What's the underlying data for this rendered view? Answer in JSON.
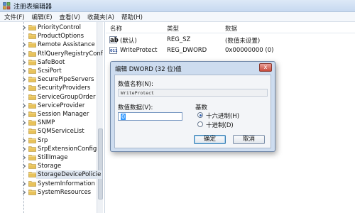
{
  "window": {
    "title": "注册表编辑器"
  },
  "menu": [
    "文件(F)",
    "编辑(E)",
    "查看(V)",
    "收藏夹(A)",
    "帮助(H)"
  ],
  "tree": {
    "items": [
      {
        "label": "PriorityControl",
        "expandable": true
      },
      {
        "label": "ProductOptions",
        "expandable": false
      },
      {
        "label": "Remote Assistance",
        "expandable": true
      },
      {
        "label": "RtlQueryRegistryConf",
        "expandable": true
      },
      {
        "label": "SafeBoot",
        "expandable": true
      },
      {
        "label": "ScsiPort",
        "expandable": true
      },
      {
        "label": "SecurePipeServers",
        "expandable": true
      },
      {
        "label": "SecurityProviders",
        "expandable": true
      },
      {
        "label": "ServiceGroupOrder",
        "expandable": false
      },
      {
        "label": "ServiceProvider",
        "expandable": true
      },
      {
        "label": "Session Manager",
        "expandable": true
      },
      {
        "label": "SNMP",
        "expandable": true
      },
      {
        "label": "SQMServiceList",
        "expandable": false
      },
      {
        "label": "Srp",
        "expandable": true
      },
      {
        "label": "SrpExtensionConfig",
        "expandable": true
      },
      {
        "label": "StillImage",
        "expandable": true
      },
      {
        "label": "Storage",
        "expandable": true
      },
      {
        "label": "StorageDevicePolicie",
        "expandable": false,
        "selected": true
      },
      {
        "label": "SystemInformation",
        "expandable": true
      },
      {
        "label": "SystemResources",
        "expandable": true
      }
    ]
  },
  "list": {
    "headers": {
      "name": "名称",
      "type": "类型",
      "data": "数据"
    },
    "rows": [
      {
        "icon": "string-value-icon",
        "icon_text": "ab",
        "name": "(默认)",
        "type": "REG_SZ",
        "data": "(数值未设置)"
      },
      {
        "icon": "binary-value-icon",
        "icon_text": "011",
        "name": "WriteProtect",
        "type": "REG_DWORD",
        "data": "0x00000000 (0)"
      }
    ]
  },
  "dialog": {
    "title": "编辑 DWORD (32 位)值",
    "close_glyph": "x",
    "value_name_label": "数值名称(N):",
    "value_name": "WriteProtect",
    "value_data_label": "数值数据(V):",
    "value_data": "0",
    "base_label": "基数",
    "base_options": [
      {
        "label": "十六进制(H)",
        "selected": true
      },
      {
        "label": "十进制(D)",
        "selected": false
      }
    ],
    "ok_label": "确定",
    "cancel_label": "取消"
  },
  "colors": {
    "accent": "#3399ff",
    "dialog_frame": "#cddcef",
    "folder": "#e8c25a"
  }
}
